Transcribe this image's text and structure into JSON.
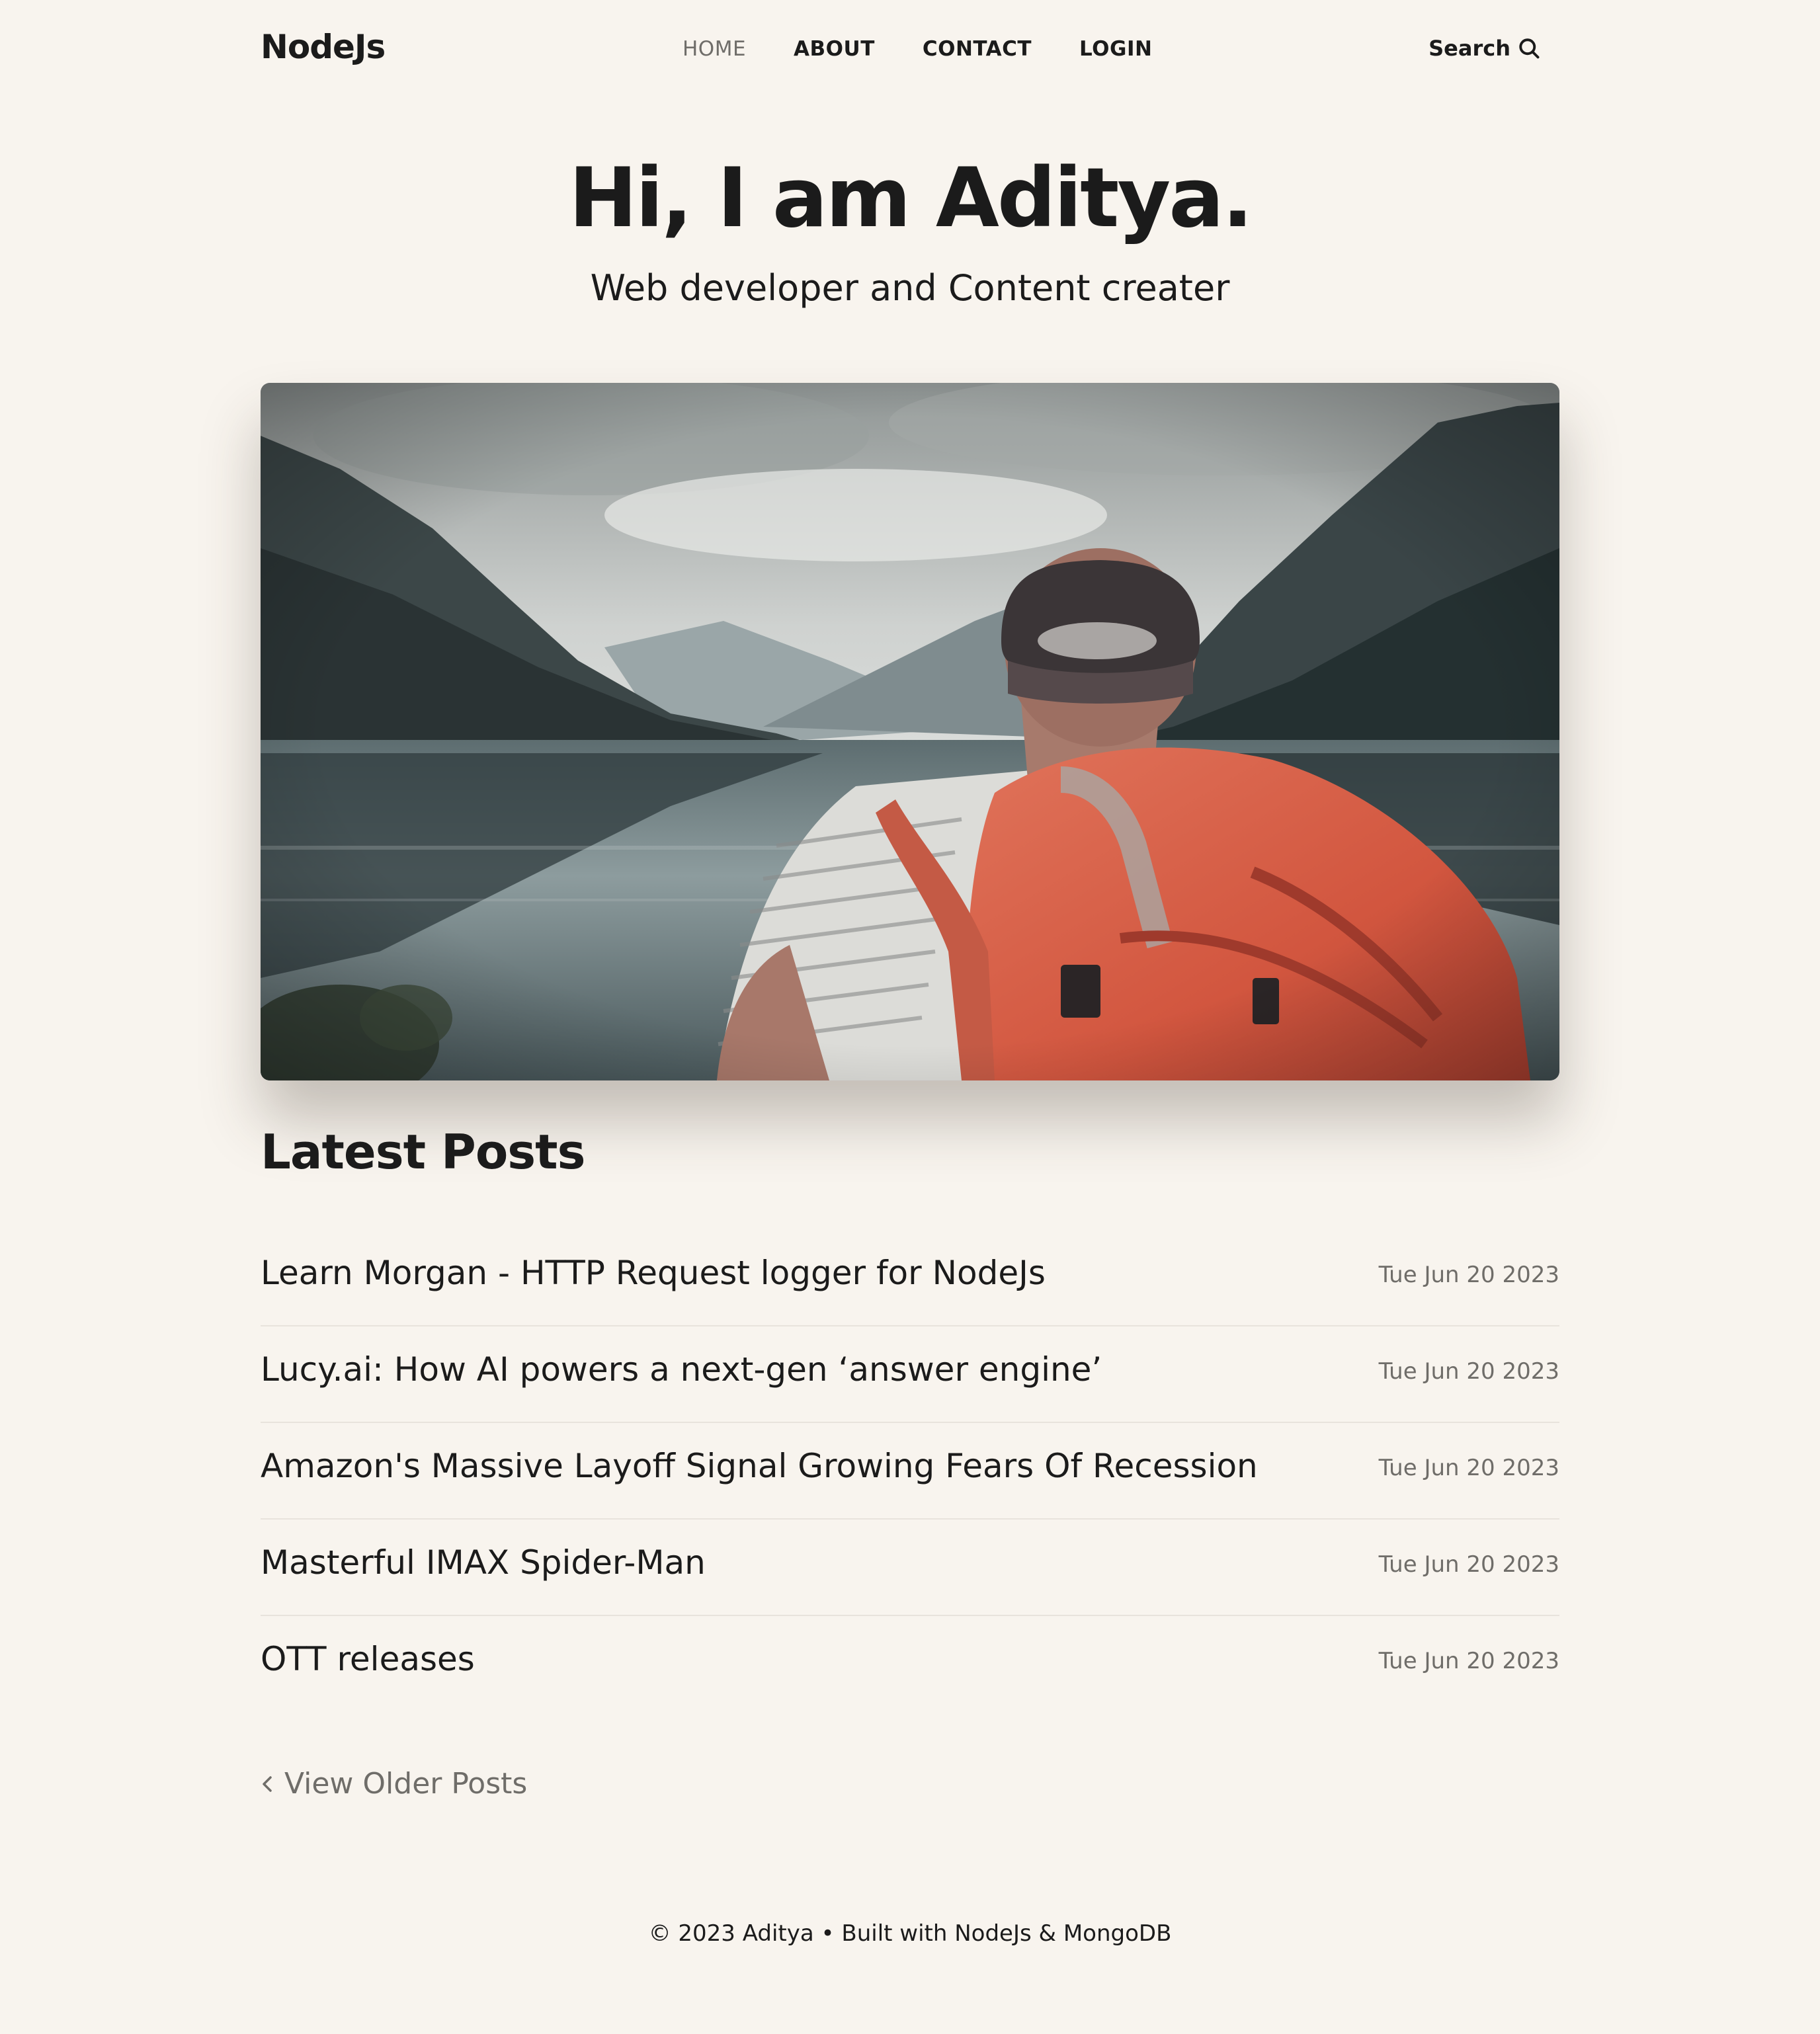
{
  "header": {
    "logo": "NodeJs",
    "nav": [
      {
        "label": "HOME",
        "active": true
      },
      {
        "label": "ABOUT",
        "active": false
      },
      {
        "label": "CONTACT",
        "active": false
      },
      {
        "label": "LOGIN",
        "active": false
      }
    ],
    "search_label": "Search",
    "search_icon": "search-icon"
  },
  "hero": {
    "title": "Hi, I am Aditya.",
    "subtitle": "Web developer and Content creater"
  },
  "posts_section": {
    "title": "Latest Posts",
    "posts": [
      {
        "title": "Learn Morgan - HTTP Request logger for NodeJs",
        "date": "Tue Jun 20 2023"
      },
      {
        "title": "Lucy.ai: How AI powers a next-gen ‘answer engine’",
        "date": "Tue Jun 20 2023"
      },
      {
        "title": "Amazon's Massive Layoff Signal Growing Fears Of Recession",
        "date": "Tue Jun 20 2023"
      },
      {
        "title": "Masterful IMAX Spider-Man",
        "date": "Tue Jun 20 2023"
      },
      {
        "title": "OTT releases",
        "date": "Tue Jun 20 2023"
      }
    ],
    "older_link": "View Older Posts",
    "older_icon": "chevron-left-icon"
  },
  "footer": {
    "text": "© 2023 Aditya • Built with NodeJs & MongoDB"
  },
  "colors": {
    "background": "#f8f4ee",
    "text": "#1b1b1b",
    "muted": "#6f6d69",
    "divider": "#e8e3dc"
  }
}
